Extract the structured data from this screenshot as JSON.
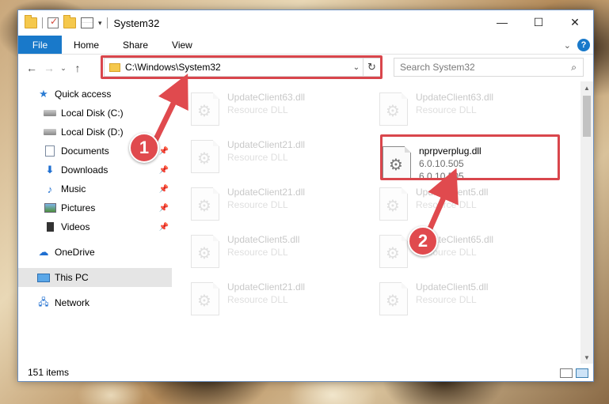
{
  "titlebar": {
    "title": "System32",
    "minimize_glyph": "—",
    "maximize_glyph": "☐",
    "close_glyph": "✕",
    "dropdown_glyph": "▾"
  },
  "ribbon": {
    "file": "File",
    "home": "Home",
    "share": "Share",
    "view": "View",
    "expand_glyph": "⌄",
    "help_glyph": "?"
  },
  "navbar": {
    "back_glyph": "←",
    "forward_glyph": "→",
    "recent_glyph": "⌄",
    "up_glyph": "↑",
    "address": "C:\\Windows\\System32",
    "address_dropdown_glyph": "⌄",
    "refresh_glyph": "↻",
    "search_placeholder": "Search System32",
    "search_glyph": "⌕"
  },
  "sidebar": {
    "items": [
      {
        "label": "Quick access",
        "icon": "star-icon"
      },
      {
        "label": "Local Disk (C:)",
        "icon": "drive-icon"
      },
      {
        "label": "Local Disk (D:)",
        "icon": "drive-icon"
      },
      {
        "label": "Documents",
        "icon": "documents-icon"
      },
      {
        "label": "Downloads",
        "icon": "downloads-icon"
      },
      {
        "label": "Music",
        "icon": "music-icon"
      },
      {
        "label": "Pictures",
        "icon": "pictures-icon"
      },
      {
        "label": "Videos",
        "icon": "videos-icon"
      },
      {
        "label": "OneDrive",
        "icon": "cloud-icon"
      },
      {
        "label": "This PC",
        "icon": "computer-icon"
      },
      {
        "label": "Network",
        "icon": "network-icon"
      }
    ],
    "pin_glyph": "📌"
  },
  "files": {
    "ghost": [
      {
        "name": "UpdateClient63.dll",
        "type": "Resource DLL"
      },
      {
        "name": "UpdateClient63.dll",
        "type": "Resource DLL"
      },
      {
        "name": "UpdateClient21.dll",
        "type": "Resource DLL"
      },
      {
        "name": "UpdateClient21.dll",
        "type": "Resource DLL"
      },
      {
        "name": "UpdateClient5.dll",
        "type": "Resource DLL"
      },
      {
        "name": "UpdateClient5.dll",
        "type": "Resource DLL"
      },
      {
        "name": "UpdateClient65.dll",
        "type": "Resource DLL"
      },
      {
        "name": "UpdateClient21.dll",
        "type": "Resource DLL"
      },
      {
        "name": "UpdateClient5.dll",
        "type": "Resource DLL"
      }
    ],
    "highlighted": {
      "name": "nprpverplug.dll",
      "version1": "6.0.10.505",
      "version2": "6.0.10.505"
    }
  },
  "statusbar": {
    "item_count": "151 items"
  },
  "annotations": {
    "badge1": "1",
    "badge2": "2",
    "color": "#e04a4e"
  },
  "colors": {
    "accent": "#1979ca",
    "highlight_box": "#d9464c"
  }
}
